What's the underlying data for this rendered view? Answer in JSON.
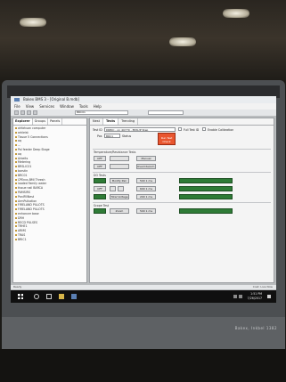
{
  "window": {
    "title": "Bakex BMS 3 - [Original B.mdb]"
  },
  "menu": [
    "File",
    "View",
    "Services",
    "Window",
    "Tools",
    "Help"
  ],
  "toolbar": {
    "field_value": "BRC01"
  },
  "left_tabs": [
    "Explorer",
    "Groups",
    "Panels"
  ],
  "tree_items": [
    "ahfahuan computer",
    "arkleist",
    "Tissue 5 Connections",
    "aq",
    "...",
    "Pal feeder Deep Stage",
    "aq",
    "Arbeits",
    "Metering",
    "BRSLIC01",
    "barstin",
    "BRC01",
    "CPEnvs BMI Thresh",
    "loaded Family water",
    "tissue nail BARCA",
    "PAMSIRS",
    "PanlFillNest",
    "ArmPulkation",
    "FIRELAND PILLOTS",
    "FIRELAND PILLOTS",
    "enhancer base",
    "DRH",
    "RECD PULSES",
    "TRHE1",
    "ARMS",
    "TRAS",
    "BRIC1"
  ],
  "right_tabs": [
    "Nest",
    "Tests",
    "Trending"
  ],
  "test": {
    "test_id_label": "Test ID",
    "test_id_value": "DRBIC - on 40779 - ERSUP Step",
    "full_test_checkbox": "Full Test ID",
    "enable_calibration_checkbox": "Enable Calibration",
    "pos_label": "Pos",
    "pos_value": "BRC1",
    "status_label": "Status",
    "red_button": "Run Test Check"
  },
  "groups": {
    "thermostat": "Temperature/Resistance Tests",
    "do_tests": "DO Tests",
    "scope": "Scope Test"
  },
  "buttons": {
    "off": "OFF",
    "manual": "Manual",
    "override": "Override/Lim 1",
    "modify": "Modify Pair",
    "time1": "500 1 ms",
    "time2": "600 1 ms",
    "time3": "200 1 ms",
    "total_voltage": "Total Voltage",
    "zoom": "Zoom"
  },
  "status": {
    "left": "Ready",
    "right": "Cost: Live Now"
  },
  "taskbar": {
    "time": "1:51 PM",
    "date": "7/26/2017"
  },
  "bezel_brand": "Bakex, Inkbel 1382",
  "colors": {
    "accent_red": "#e9562f",
    "indicator_green": "#2e7b36"
  }
}
